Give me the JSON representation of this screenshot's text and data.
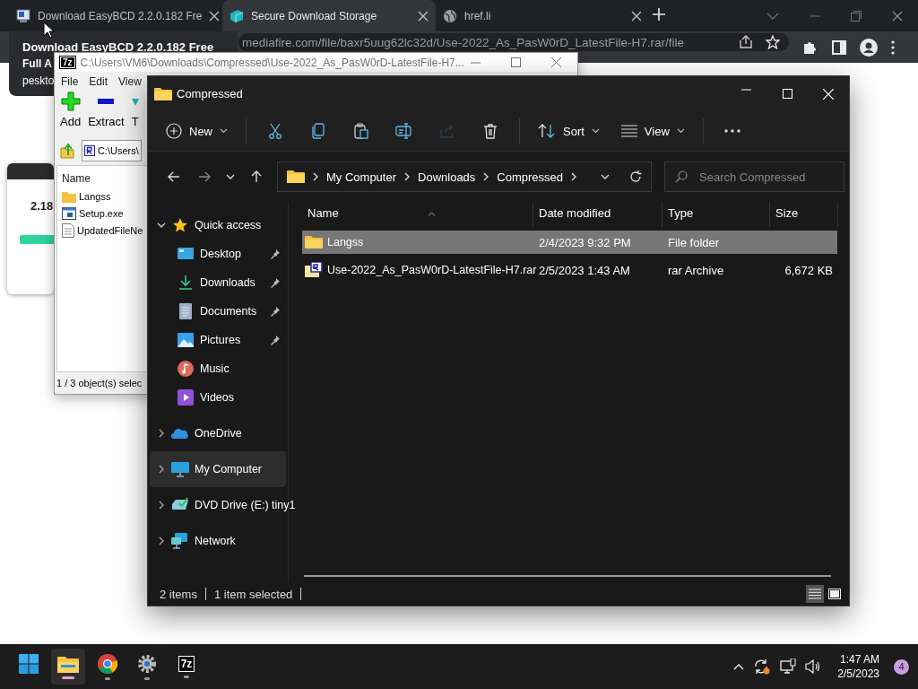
{
  "browser": {
    "tabs": [
      {
        "kind": "app",
        "title": "Download EasyBCD 2.2.0.182 Fre",
        "selected": false
      },
      {
        "kind": "storage",
        "title": "Secure Download Storage",
        "selected": true
      },
      {
        "kind": "globe",
        "title": "href.li",
        "selected": false
      }
    ],
    "address": "mediafire.com/file/baxr5uug62lc32d/Use-2022_As_PasW0rD_LatestFile-H7.rar/file",
    "hover_card": [
      "Download EasyBCD 2.2.0.182 Free",
      "Full A",
      "peskto"
    ],
    "thumbnail": {
      "version": "2.18"
    }
  },
  "archiver": {
    "logo": "7z",
    "title": "C:\\Users\\VM6\\Downloads\\Compressed\\Use-2022_As_PasW0rD-LatestFile-H7...",
    "menu": [
      "File",
      "Edit",
      "View"
    ],
    "tools": [
      {
        "kind": "add",
        "label": "Add"
      },
      {
        "kind": "extract",
        "label": "Extract"
      },
      {
        "kind": "test",
        "label": "T"
      }
    ],
    "path": "C:\\Users\\",
    "column": "Name",
    "files": [
      {
        "kind": "folder",
        "name": "Langss"
      },
      {
        "kind": "exe",
        "name": "Setup.exe"
      },
      {
        "kind": "text",
        "name": "UpdatedFileNe"
      }
    ],
    "status": "1 / 3 object(s) selec"
  },
  "explorer": {
    "title": "Compressed",
    "toolbar": [
      {
        "kind": "new",
        "label": "New",
        "disabled": false
      },
      {
        "kind": "cut",
        "disabled": false
      },
      {
        "kind": "copy",
        "disabled": false
      },
      {
        "kind": "paste",
        "disabled": false
      },
      {
        "kind": "rename",
        "disabled": false
      },
      {
        "kind": "share",
        "disabled": true
      },
      {
        "kind": "delete",
        "disabled": false
      },
      {
        "kind": "sort",
        "label": "Sort",
        "disabled": false
      },
      {
        "kind": "view",
        "label": "View",
        "disabled": false
      },
      {
        "kind": "more",
        "disabled": false
      }
    ],
    "breadcrumb": [
      "My Computer",
      "Downloads",
      "Compressed"
    ],
    "search": {
      "placeholder": "Search Compressed"
    },
    "nav": [
      {
        "kind": "star",
        "label": "Quick access",
        "expanded": true,
        "selected": false,
        "children": [
          {
            "kind": "desktop",
            "label": "Desktop",
            "pinned": true,
            "selected": false
          },
          {
            "kind": "downloads",
            "label": "Downloads",
            "pinned": true,
            "selected": false
          },
          {
            "kind": "documents",
            "label": "Documents",
            "pinned": true,
            "selected": false
          },
          {
            "kind": "pictures",
            "label": "Pictures",
            "pinned": true,
            "selected": false
          },
          {
            "kind": "music",
            "label": "Music",
            "pinned": false,
            "selected": false
          },
          {
            "kind": "videos",
            "label": "Videos",
            "pinned": false,
            "selected": false
          }
        ]
      },
      {
        "kind": "cloud",
        "label": "OneDrive",
        "expanded": false,
        "selected": false
      },
      {
        "kind": "computer",
        "label": "My Computer",
        "expanded": false,
        "selected": true
      },
      {
        "kind": "dvd",
        "label": "DVD Drive (E:) tiny1",
        "expanded": false,
        "selected": false
      },
      {
        "kind": "network",
        "label": "Network",
        "expanded": false,
        "selected": false
      }
    ],
    "columns": [
      "Name",
      "Date modified",
      "Type",
      "Size"
    ],
    "rows": [
      {
        "kind": "folder",
        "name": "Langss",
        "date": "2/4/2023 9:32 PM",
        "type": "File folder",
        "selected": true
      },
      {
        "kind": "rar",
        "name": "Use-2022_As_PasW0rD-LatestFile-H7.rar",
        "date": "2/5/2023 1:43 AM",
        "type": "rar Archive",
        "size": "6,672 KB",
        "selected": false
      }
    ],
    "status": [
      "2 items",
      "1 item selected"
    ],
    "views": [
      {
        "kind": "details",
        "selected": true
      },
      {
        "kind": "tiles",
        "selected": false
      }
    ]
  },
  "taskbar": {
    "apps": [
      {
        "kind": "start",
        "running": false,
        "active": false
      },
      {
        "kind": "explorer",
        "running": true,
        "active": true
      },
      {
        "kind": "chrome",
        "running": true,
        "active": false
      },
      {
        "kind": "settings",
        "running": true,
        "active": false
      },
      {
        "kind": "archiver",
        "running": true,
        "active": false,
        "logo": "7z"
      }
    ],
    "time": "1:47 AM",
    "date": "2/5/2023",
    "badge": "4"
  }
}
